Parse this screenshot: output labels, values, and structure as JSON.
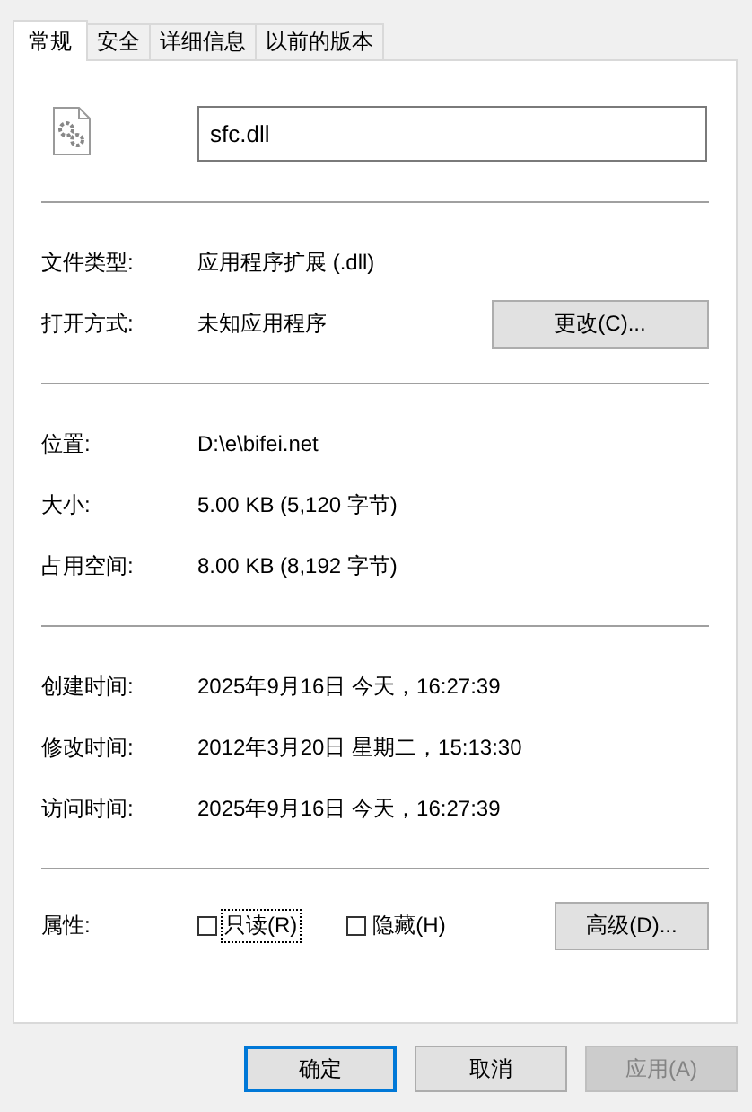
{
  "tabs": [
    {
      "label": "常规",
      "selected": true
    },
    {
      "label": "安全",
      "selected": false
    },
    {
      "label": "详细信息",
      "selected": false
    },
    {
      "label": "以前的版本",
      "selected": false
    }
  ],
  "file": {
    "name": "sfc.dll"
  },
  "sections": [
    {
      "rows": [
        {
          "label": "文件类型:",
          "value": "应用程序扩展 (.dll)"
        },
        {
          "label": "打开方式:",
          "value": "未知应用程序",
          "button": "更改(C)..."
        }
      ]
    },
    {
      "rows": [
        {
          "label": "位置:",
          "value": "D:\\e\\bifei.net"
        },
        {
          "label": "大小:",
          "value": "5.00 KB (5,120 字节)"
        },
        {
          "label": "占用空间:",
          "value": "8.00 KB (8,192 字节)"
        }
      ]
    },
    {
      "rows": [
        {
          "label": "创建时间:",
          "value": "2025年9月16日 今天，16:27:39"
        },
        {
          "label": "修改时间:",
          "value": "2012年3月20日 星期二，15:13:30"
        },
        {
          "label": "访问时间:",
          "value": "2025年9月16日 今天，16:27:39"
        }
      ]
    }
  ],
  "attributes": {
    "label": "属性:",
    "checkboxes": [
      {
        "label": "只读(R)",
        "checked": false,
        "focused": true
      },
      {
        "label": "隐藏(H)",
        "checked": false,
        "focused": false
      }
    ],
    "button": "高级(D)..."
  },
  "buttons": [
    {
      "label": "确定",
      "kind": "default"
    },
    {
      "label": "取消",
      "kind": "normal"
    },
    {
      "label": "应用(A)",
      "kind": "disabled"
    }
  ]
}
